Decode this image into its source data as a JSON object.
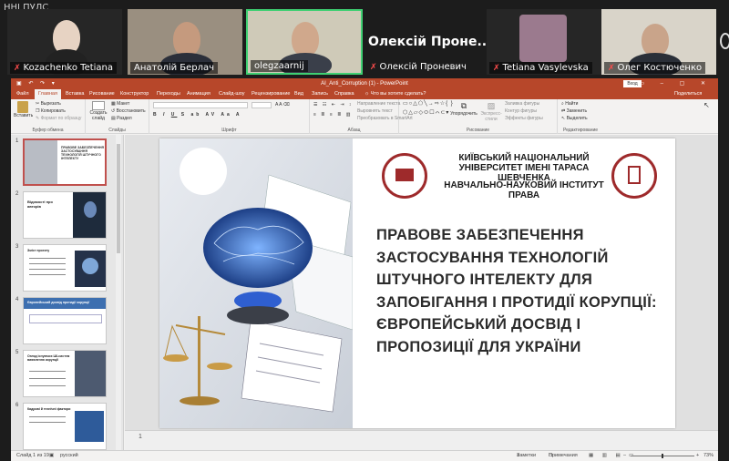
{
  "conference": {
    "label": "ННІ ПУЛС",
    "participants": [
      {
        "name": "Kozachenko Tetiana",
        "muted": true
      },
      {
        "name": "Анатолій Берлач",
        "muted": false
      },
      {
        "name": "olegzaarnij",
        "muted": false,
        "active": true
      },
      {
        "name": "Олексій Проневич",
        "muted": true,
        "display_name": "Олексій Проне..."
      },
      {
        "name": "Tetiana Vasylevska",
        "muted": true
      },
      {
        "name": "Олег Костюченко",
        "muted": true
      }
    ]
  },
  "app": {
    "doc_title": "AI_Anti_Corruption (1)  -  PowerPoint",
    "sign_in": "Вход",
    "tabs": [
      "Файл",
      "Главная",
      "Вставка",
      "Рисование",
      "Конструктор",
      "Переходы",
      "Анимация",
      "Слайд-шоу",
      "Рецензирование",
      "Вид",
      "Запись",
      "Справка",
      "Что вы хотите сделать?",
      "Поделиться"
    ],
    "ribbon": {
      "paste": "Вставить",
      "cut": "Вырезать",
      "copy": "Копировать",
      "format_painter": "Формат по образцу",
      "clipboard": "Буфер обмена",
      "new_slide": "Создать слайд",
      "layout": "Макет",
      "reset": "Восстановить",
      "section": "Раздел",
      "slides": "Слайды",
      "font": "Шрифт",
      "text_direction": "Направление текста",
      "align_text": "Выровнять текст",
      "smartart": "Преобразовать в SmartArt",
      "paragraph": "Абзац",
      "arrange": "Упорядочить",
      "quick_styles": "Экспресс-стили",
      "shape_fill": "Заливка фигуры",
      "shape_outline": "Контур фигуры",
      "shape_effects": "Эффекты фигуры",
      "drawing": "Рисование",
      "find": "Найти",
      "replace": "Заменить",
      "select": "Выделить",
      "editing": "Редактирование"
    }
  },
  "slide": {
    "university": "КИЇВСЬКИЙ НАЦІОНАЛЬНИЙ УНІВЕРСИТЕТ ІМЕНІ ТАРАСА ШЕВЧЕНКА",
    "institute": "НАВЧАЛЬНО-НАУКОВИЙ ІНСТИТУТ ПРАВА",
    "title": "ПРАВОВЕ ЗАБЕЗПЕЧЕННЯ ЗАСТОСУВАННЯ ТЕХНОЛОГІЙ ШТУЧНОГО ІНТЕЛЕКТУ ДЛЯ ЗАПОБІГАННЯ І ПРОТИДІЇ КОРУПЦІЇ: ЄВРОПЕЙСЬКИЙ ДОСВІД І ПРОПОЗИЦІЇ ДЛЯ УКРАЇНИ"
  },
  "thumbnails": [
    {
      "num": "1",
      "caption": "ПРАВОВЕ ЗАБЕЗПЕЧЕННЯ ЗАСТОСУВАННЯ ТЕХНОЛОГІЙ ШТУЧНОГО ІНТЕЛЕКТУ"
    },
    {
      "num": "2",
      "caption": "Відомості про авторів"
    },
    {
      "num": "3",
      "caption": "Зміст проекту"
    },
    {
      "num": "4",
      "caption": "Європейський досвід протидії корупції"
    },
    {
      "num": "5",
      "caption": "Огляд існуючих ШІ-систем виявлення корупції"
    },
    {
      "num": "6",
      "caption": "Кадрові й технічні фактори"
    }
  ],
  "notes_counter": "1",
  "status": {
    "slide": "Слайд 1 из 19",
    "lang": "русский",
    "notes": "Заметки",
    "comments": "Примечания",
    "zoom": "73%"
  },
  "colors": {
    "ppt_accent": "#b7472a",
    "active_tile": "#3fcf72",
    "muted_mic": "#ff4d4d"
  }
}
